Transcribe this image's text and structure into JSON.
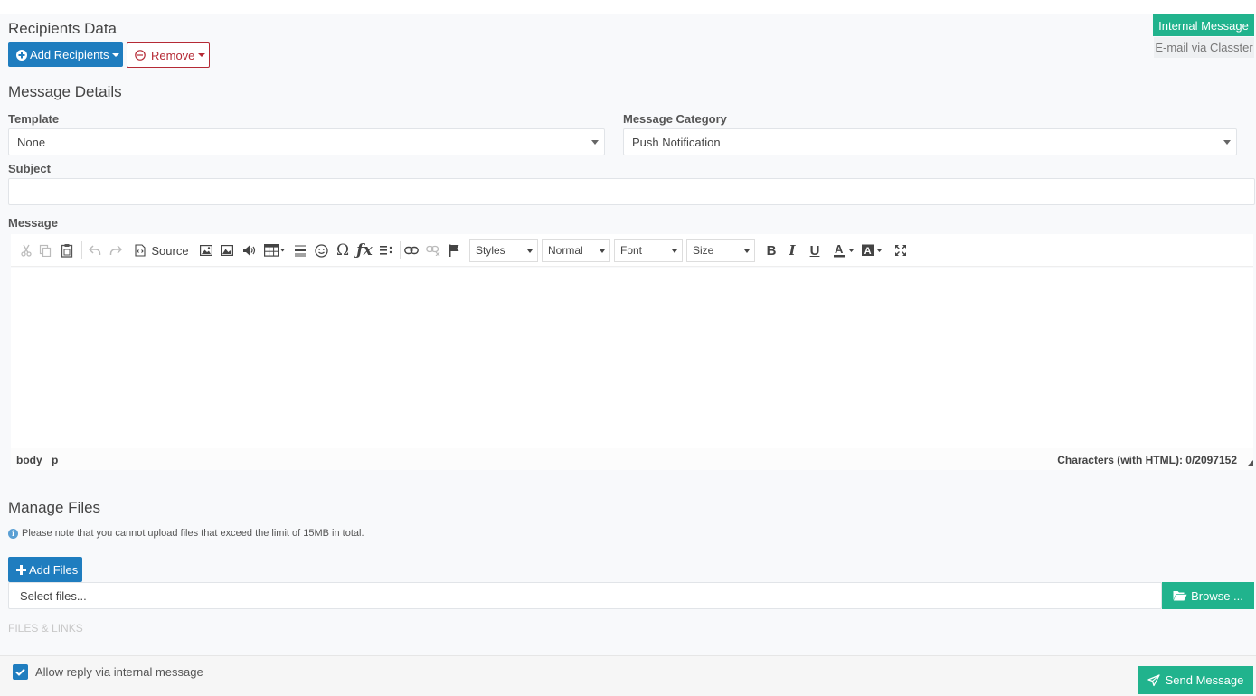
{
  "recipients": {
    "title": "Recipients Data",
    "add_label": "Add Recipients",
    "remove_label": "Remove"
  },
  "tabs": {
    "internal": "Internal Message",
    "email": "E-mail via Classter"
  },
  "details": {
    "title": "Message Details",
    "template_label": "Template",
    "template_value": "None",
    "category_label": "Message Category",
    "category_value": "Push Notification",
    "subject_label": "Subject",
    "subject_value": "",
    "message_label": "Message"
  },
  "editor": {
    "source_label": "Source",
    "styles_label": "Styles",
    "format_label": "Normal",
    "font_label": "Font",
    "size_label": "Size",
    "path_body": "body",
    "path_p": "p",
    "char_count": "Characters (with HTML): 0/2097152"
  },
  "files": {
    "title": "Manage Files",
    "note": "Please note that you cannot upload files that exceed the limit of 15MB in total.",
    "add_label": "Add Files",
    "select_placeholder": "Select files...",
    "browse_label": "Browse ...",
    "files_links_label": "FILES & LINKS"
  },
  "footer": {
    "allow_reply_label": "Allow reply via internal message",
    "allow_reply_checked": true,
    "send_label": "Send Message"
  },
  "colors": {
    "primary": "#1f7dbf",
    "danger": "#b52a35",
    "success": "#21b38d"
  }
}
